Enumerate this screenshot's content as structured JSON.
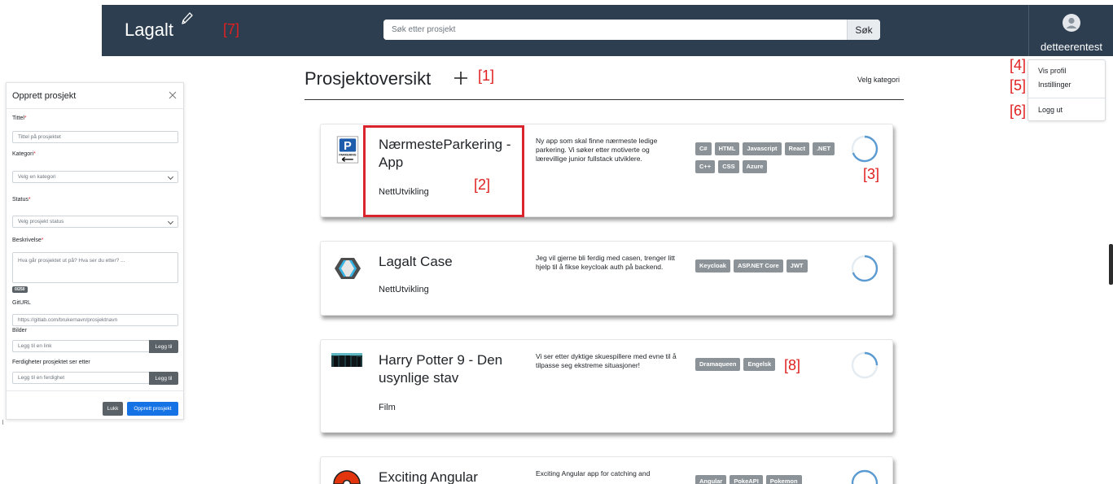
{
  "app": {
    "logo_text": "Lagalt"
  },
  "search": {
    "placeholder": "Søk etter prosjekt",
    "button_label": "Søk"
  },
  "user": {
    "username": "detteerentest",
    "menu": [
      {
        "label": "Vis profil"
      },
      {
        "label": "Instillinger"
      },
      {
        "label": "Logg ut"
      }
    ]
  },
  "annotations": {
    "a1": "[1]",
    "a2": "[2]",
    "a3": "[3]",
    "a4": "[4]",
    "a5": "[5]",
    "a6": "[6]",
    "a7": "[7]",
    "a8": "[8]"
  },
  "main": {
    "title": "Prosjektoversikt",
    "category_filter": "Velg kategori",
    "projects": [
      {
        "name": "NærmesteParkering - App",
        "category": "NettUtvikling",
        "description": "Ny app som skal finne nærmeste ledige parkering. Vi søker etter motiverte og lærevillige junior fullstack utviklere.",
        "tags": [
          "C#",
          "HTML",
          "Javascript",
          "React",
          ".NET",
          "C++",
          "CSS",
          "Azure"
        ],
        "thumbnail_text": "PARKERING"
      },
      {
        "name": "Lagalt Case",
        "category": "NettUtvikling",
        "description": "Jeg vil gjerne bli ferdig med casen, trenger litt hjelp til å fikse keycloak auth på backend.",
        "tags": [
          "Keycloak",
          "ASP.NET Core",
          "JWT"
        ]
      },
      {
        "name": "Harry Potter 9 - Den usynlige stav",
        "category": "Film",
        "description": "Vi ser etter dyktige skuespillere med evne til å tilpasse seg ekstreme situasjoner!",
        "tags": [
          "Dramaqueen",
          "Engelsk"
        ]
      },
      {
        "name": "Exciting Angular",
        "category": "",
        "description": "Exciting Angular app for catching and",
        "tags": [
          "Angular",
          "PokeAPI",
          "Pokemon"
        ]
      }
    ]
  },
  "modal": {
    "title": "Opprett prosjekt",
    "fields": {
      "title_label": "Tittel",
      "title_placeholder": "Tittel på prosjektet",
      "category_label": "Kategori",
      "category_value": "Velg en kategori",
      "status_label": "Status",
      "status_value": "Velg prosjekt status",
      "description_label": "Beskrivelse",
      "description_placeholder": "Hva går prosjektet ut på? Hva ser du etter? ...",
      "char_counter": "0/250",
      "giturl_label": "GitURL",
      "giturl_placeholder": "https://gitlab.com/brukernavn/prosjektnavn",
      "images_label": "Bilder",
      "images_placeholder": "Legg til en link",
      "images_add": "Legg til",
      "skills_label": "Ferdigheter prosjektet ser etter",
      "skills_placeholder": "Legg til en ferdighet",
      "skills_add": "Legg til"
    },
    "close_button": "Lukk",
    "create_button": "Opprett prosjekt"
  },
  "colors": {
    "navbar": "#2c3e50",
    "tag": "#8c9398",
    "primary_button": "#1673e6",
    "secondary_button": "#5a6268",
    "highlight": "#d9232d",
    "annotation": "#e02020"
  }
}
